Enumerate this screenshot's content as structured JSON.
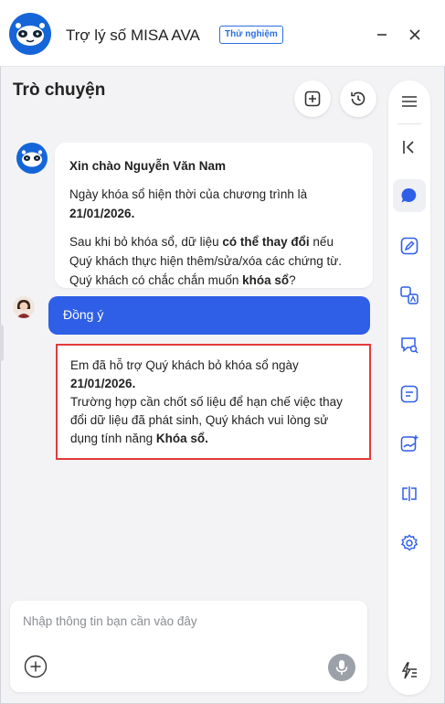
{
  "header": {
    "title": "Trợ lý số MISA AVA",
    "badge": "Thử nghiệm"
  },
  "conversation": {
    "title": "Trò chuyện"
  },
  "messages": {
    "bot": {
      "greeting": "Xin chào Nguyễn Văn Nam",
      "line1_prefix": "Ngày khóa sổ hiện thời của chương trình là",
      "line1_date": "21/01/2026.",
      "line2_a": "Sau khi bỏ khóa sổ, dữ liệu ",
      "line2_bold": "có thể thay đổi",
      "line2_b": " nếu Quý khách thực hiện thêm/sửa/xóa các chứng từ.",
      "line3_a": "Quý khách có chắc chắn muốn ",
      "line3_bold": "khóa sổ",
      "line3_b": "?"
    },
    "user": {
      "text": "Đồng ý"
    },
    "reply": {
      "line1": "Em đã hỗ trợ Quý khách bỏ khóa sổ ngày",
      "date": "21/01/2026.",
      "line2": "Trường hợp cần chốt số liệu để hạn chế việc thay đổi dữ liệu đã phát sinh, Quý khách vui lòng sử dụng tính năng ",
      "feature": "Khóa sổ."
    }
  },
  "input": {
    "placeholder": "Nhập thông tin bạn cần vào đây"
  },
  "colors": {
    "accent": "#2f5fe6",
    "brand": "#1565d8",
    "highlight_border": "#e23a3a"
  },
  "icons": {
    "header": [
      "close-icon",
      "minimize-icon"
    ],
    "rail": [
      "menu-icon",
      "collapse-icon",
      "chat-icon",
      "edit-icon",
      "translate-icon",
      "chat-search-icon",
      "note-icon",
      "image-ai-icon",
      "compare-icon",
      "settings-icon",
      "quick-action-icon"
    ]
  }
}
